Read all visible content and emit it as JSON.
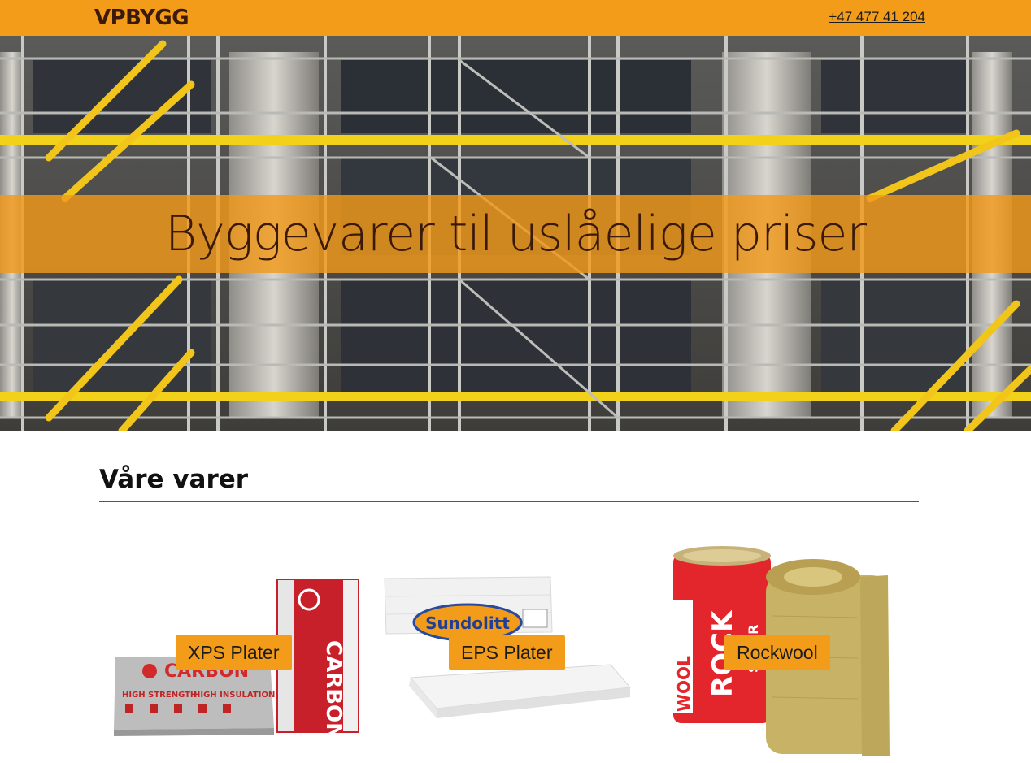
{
  "header": {
    "logo": "VPBYGG",
    "phone": "+47 477 41 204"
  },
  "hero": {
    "title": "Byggevarer til uslåelige priser",
    "image": "scaffolding-photo"
  },
  "products_section": {
    "title": "Våre varer",
    "items": [
      {
        "label": "XPS Plater",
        "image": "carbon-xps-boards-photo",
        "brand_text": [
          "CARBON",
          "HIGH STRENGTH",
          "HIGH INSULATION"
        ]
      },
      {
        "label": "EPS Plater",
        "image": "sundolitt-eps-boards-photo",
        "brand_text": [
          "Sundolitt"
        ]
      },
      {
        "label": "Rockwool",
        "image": "rockwool-roll-photo",
        "brand_text": [
          "ROCK",
          "WOOL",
          "SUPER"
        ]
      }
    ]
  },
  "colors": {
    "accent": "#f39c1a",
    "logo": "#3b1a0c",
    "hero_text": "#3a1909"
  }
}
